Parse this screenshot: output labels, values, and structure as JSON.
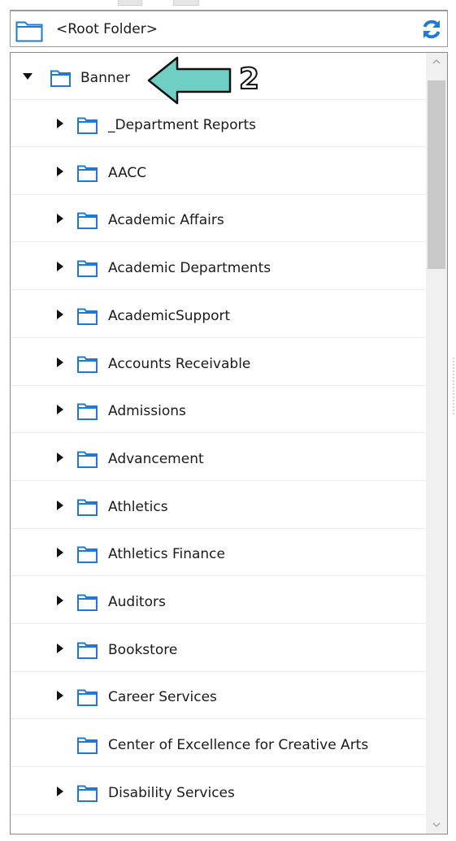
{
  "root_bar": {
    "label": "<Root Folder>",
    "folder_icon": "folder-icon",
    "refresh_icon": "refresh-icon",
    "accent": "#1f7ad6"
  },
  "tree": {
    "root_item": {
      "label": "Banner",
      "expanded": true
    },
    "items": [
      {
        "label": "_Department Reports",
        "has_children": true
      },
      {
        "label": "AACC",
        "has_children": true
      },
      {
        "label": "Academic Affairs",
        "has_children": true
      },
      {
        "label": "Academic Departments",
        "has_children": true
      },
      {
        "label": "AcademicSupport",
        "has_children": true
      },
      {
        "label": "Accounts Receivable",
        "has_children": true
      },
      {
        "label": "Admissions",
        "has_children": true
      },
      {
        "label": "Advancement",
        "has_children": true
      },
      {
        "label": "Athletics",
        "has_children": true
      },
      {
        "label": "Athletics Finance",
        "has_children": true
      },
      {
        "label": "Auditors",
        "has_children": true
      },
      {
        "label": "Bookstore",
        "has_children": true
      },
      {
        "label": "Career Services",
        "has_children": true
      },
      {
        "label": "Center of Excellence for Creative Arts",
        "has_children": false
      },
      {
        "label": "Disability Services",
        "has_children": true
      }
    ],
    "folder_color": "#1f7ad6"
  },
  "annotation": {
    "number": "2",
    "arrow_color": "#6fcfc4"
  },
  "scrollbar": {
    "up_icon": "chevron-up-icon",
    "down_icon": "chevron-down-icon"
  }
}
